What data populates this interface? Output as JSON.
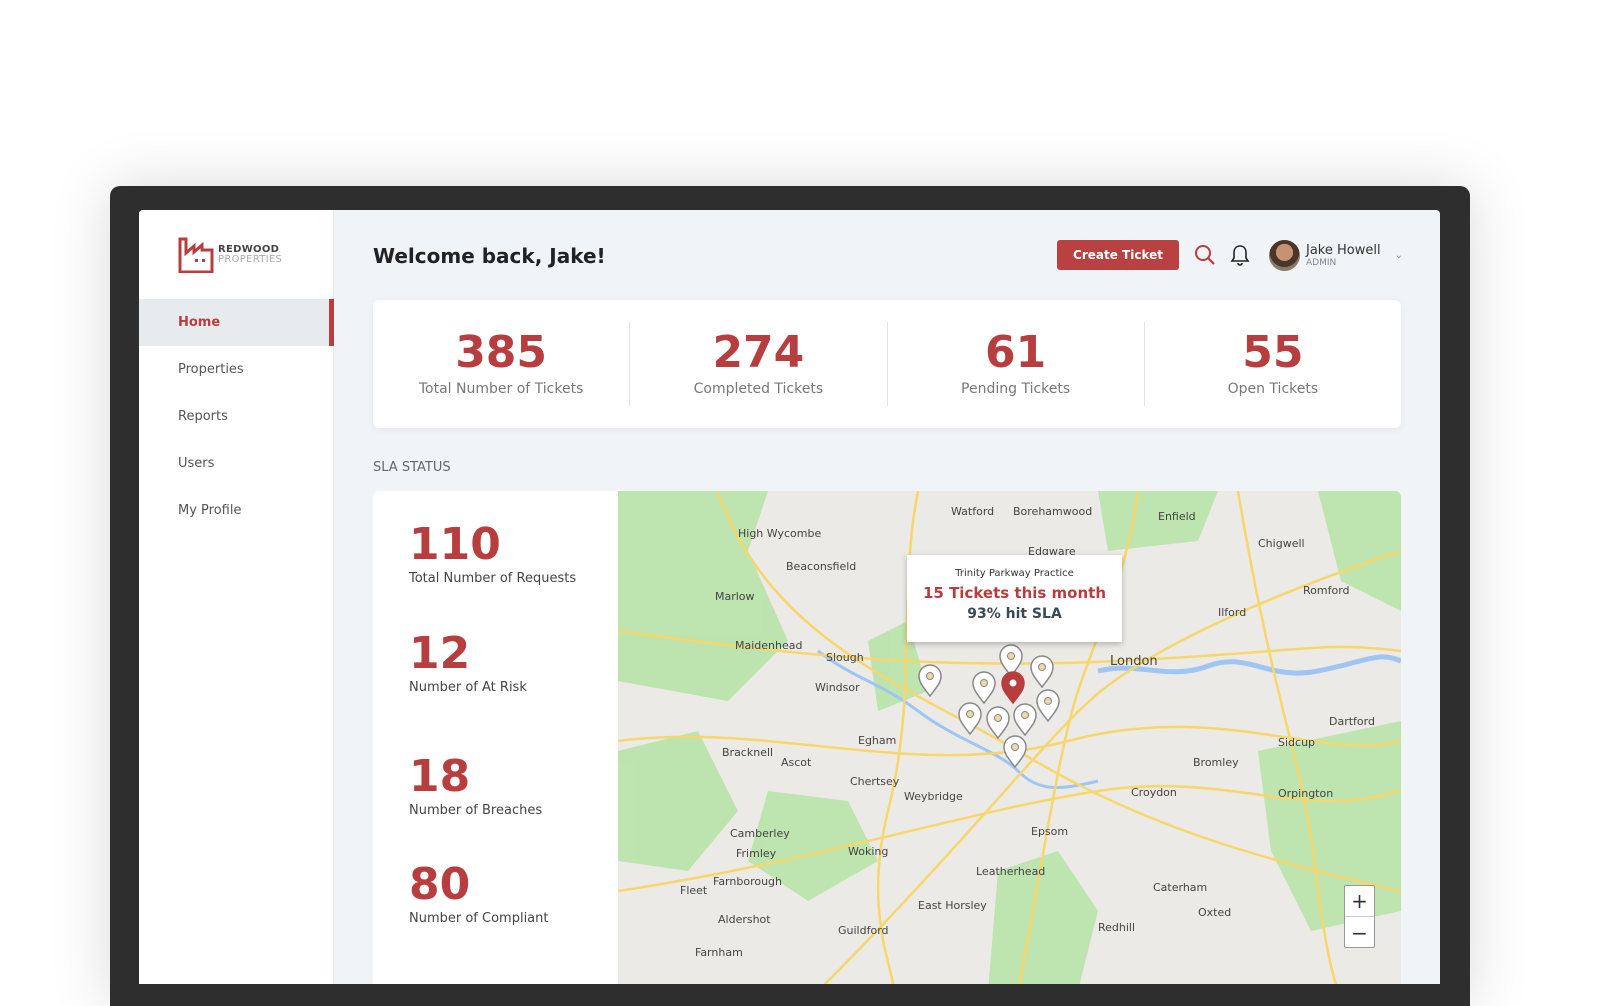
{
  "brand": {
    "line1": "REDWOOD",
    "line2": "PROPERTIES",
    "color": "#b83d3e"
  },
  "sidebar": {
    "items": [
      {
        "label": "Home",
        "active": true
      },
      {
        "label": "Properties"
      },
      {
        "label": "Reports"
      },
      {
        "label": "Users"
      },
      {
        "label": "My Profile"
      }
    ]
  },
  "header": {
    "title": "Welcome back, Jake!",
    "create_label": "Create Ticket",
    "user_name": "Jake Howell",
    "user_role": "ADMIN"
  },
  "stats": [
    {
      "value": "385",
      "label": "Total Number of Tickets"
    },
    {
      "value": "274",
      "label": "Completed Tickets"
    },
    {
      "value": "61",
      "label": "Pending Tickets"
    },
    {
      "value": "55",
      "label": "Open Tickets"
    }
  ],
  "sla": {
    "label": "SLA STATUS",
    "metrics": [
      {
        "value": "110",
        "label": "Total Number of Requests"
      },
      {
        "value": "12",
        "label": "Number of At Risk"
      },
      {
        "value": "18",
        "label": "Number of Breaches"
      },
      {
        "value": "80",
        "label": "Number of Compliant"
      }
    ]
  },
  "map": {
    "tooltip": {
      "place": "Trinity Parkway Practice",
      "tickets": "15 Tickets this month",
      "sla": "93% hit SLA"
    },
    "labels": [
      "Watford",
      "Enfield",
      "High Wycombe",
      "London",
      "Slough",
      "Maidenhead",
      "Bracknell",
      "Woking",
      "Croydon",
      "Epsom",
      "Guildford",
      "Dartford",
      "Bromley",
      "Romford",
      "Farnborough",
      "Aldershot",
      "Leatherhead",
      "Ilford",
      "Chertsey",
      "Egham",
      "Windsor",
      "Oxted",
      "Fleet",
      "Farnham",
      "Ascot",
      "Borehamwood",
      "Edgware",
      "Marlow",
      "Beaconsfield",
      "Camberley",
      "Frimley",
      "Weybridge",
      "Sidcup",
      "Caterham",
      "East Horsley",
      "Redhill",
      "Orpington",
      "Chigwell"
    ],
    "zoom_in": "+",
    "zoom_out": "−"
  }
}
